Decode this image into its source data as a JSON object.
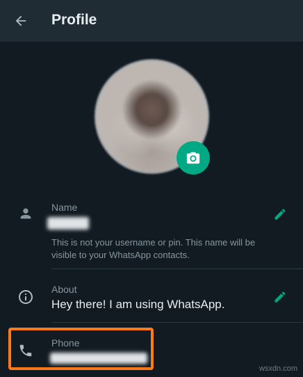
{
  "header": {
    "title": "Profile"
  },
  "profile": {
    "name": {
      "label": "Name",
      "note": "This is not your username or pin. This name will be visible to your WhatsApp contacts."
    },
    "about": {
      "label": "About",
      "value": "Hey there! I am using WhatsApp."
    },
    "phone": {
      "label": "Phone"
    }
  },
  "watermark": "wsxdn.com",
  "colors": {
    "accent": "#00a884",
    "highlight": "#ff7a1a",
    "background": "#121b22"
  }
}
